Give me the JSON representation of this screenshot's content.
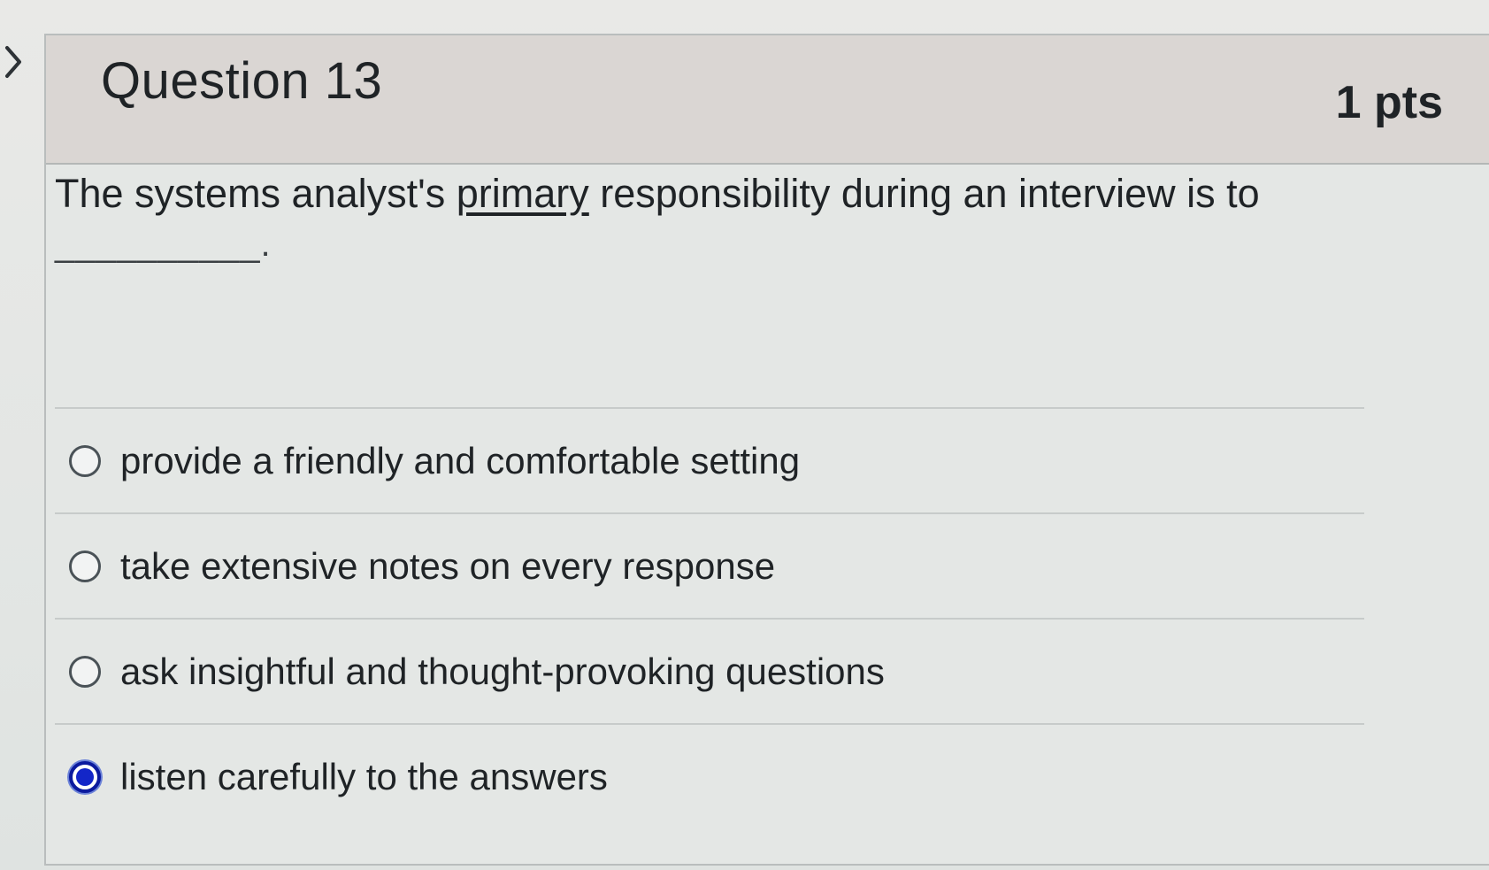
{
  "question": {
    "title": "Question 13",
    "points": "1 pts",
    "text_before": "The systems analyst's ",
    "text_underlined": "primary",
    "text_after": " responsibility during an interview is to",
    "blank": "__________."
  },
  "answers": [
    {
      "label": "provide a friendly and comfortable setting",
      "selected": false
    },
    {
      "label": "take extensive notes on every response",
      "selected": false
    },
    {
      "label": "ask insightful and thought-provoking questions",
      "selected": false
    },
    {
      "label": "listen carefully to the answers",
      "selected": true
    }
  ],
  "colors": {
    "header_bg": "#dad6d3",
    "selected_radio": "#1326c8"
  },
  "icons": {
    "collapse": "chevron-right-icon"
  }
}
